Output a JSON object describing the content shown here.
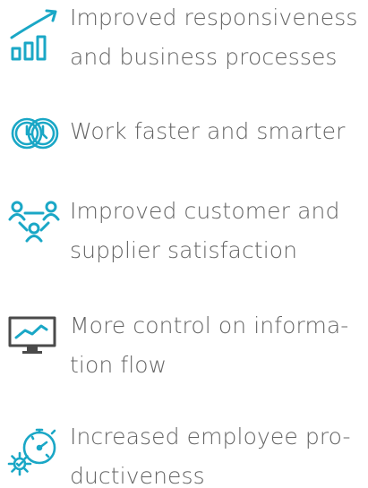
{
  "accent_color": "#1aa7c6",
  "text_color": "#646464",
  "benefits": [
    {
      "icon": "growth-chart-icon",
      "lines": [
        "Improved responsiveness",
        "and business processes"
      ]
    },
    {
      "icon": "clocks-icon",
      "lines": [
        "Work faster and smarter"
      ]
    },
    {
      "icon": "people-network-icon",
      "lines": [
        "Improved customer and",
        "supplier satisfaction"
      ]
    },
    {
      "icon": "monitor-chart-icon",
      "lines": [
        "More control on informa-",
        "tion flow"
      ]
    },
    {
      "icon": "stopwatch-gear-icon",
      "lines": [
        "Increased employee pro-",
        "ductiveness"
      ]
    }
  ]
}
